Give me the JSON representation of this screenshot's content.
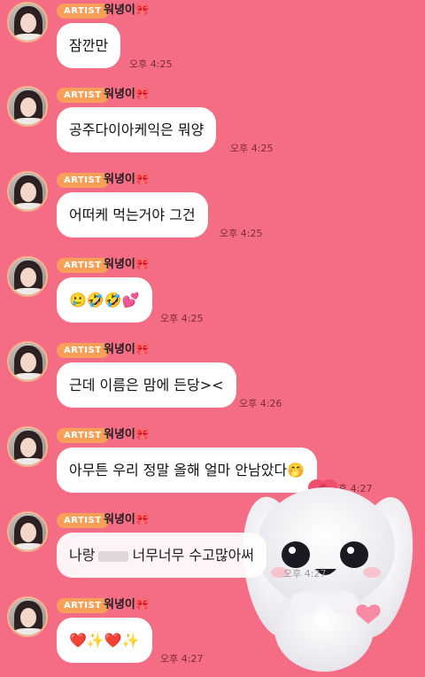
{
  "sender": {
    "badge": "ARTIST",
    "name": "워녕이🎀"
  },
  "messages": [
    {
      "text": "잠깐만",
      "time": "오후 4:25"
    },
    {
      "text": "공주다이아케익은 뭐양",
      "time": "오후 4:25"
    },
    {
      "text": "어떠케 먹는거야 그건",
      "time": "오후 4:25"
    },
    {
      "text": "🥲🤣🤣💕",
      "time": "오후 4:25"
    },
    {
      "text": "근데 이름은 맘에 든당><",
      "time": "오후 4:26"
    },
    {
      "text": "아무튼 우리 정말 올해 얼마 안남았다🤭",
      "time": "오후 4:27"
    },
    {
      "text_before": "나랑",
      "text_after": "너무너무 수고많아써",
      "time": "오후 4:27"
    },
    {
      "text": "❤️✨❤️✨",
      "time": "오후 4:27"
    }
  ],
  "colors": {
    "background": "#f46d85",
    "bubble": "#ffffff",
    "badge": "#f8a05a"
  },
  "icons": {
    "mascot": "white-bunny-mascot",
    "heart": "heart-sticker"
  }
}
